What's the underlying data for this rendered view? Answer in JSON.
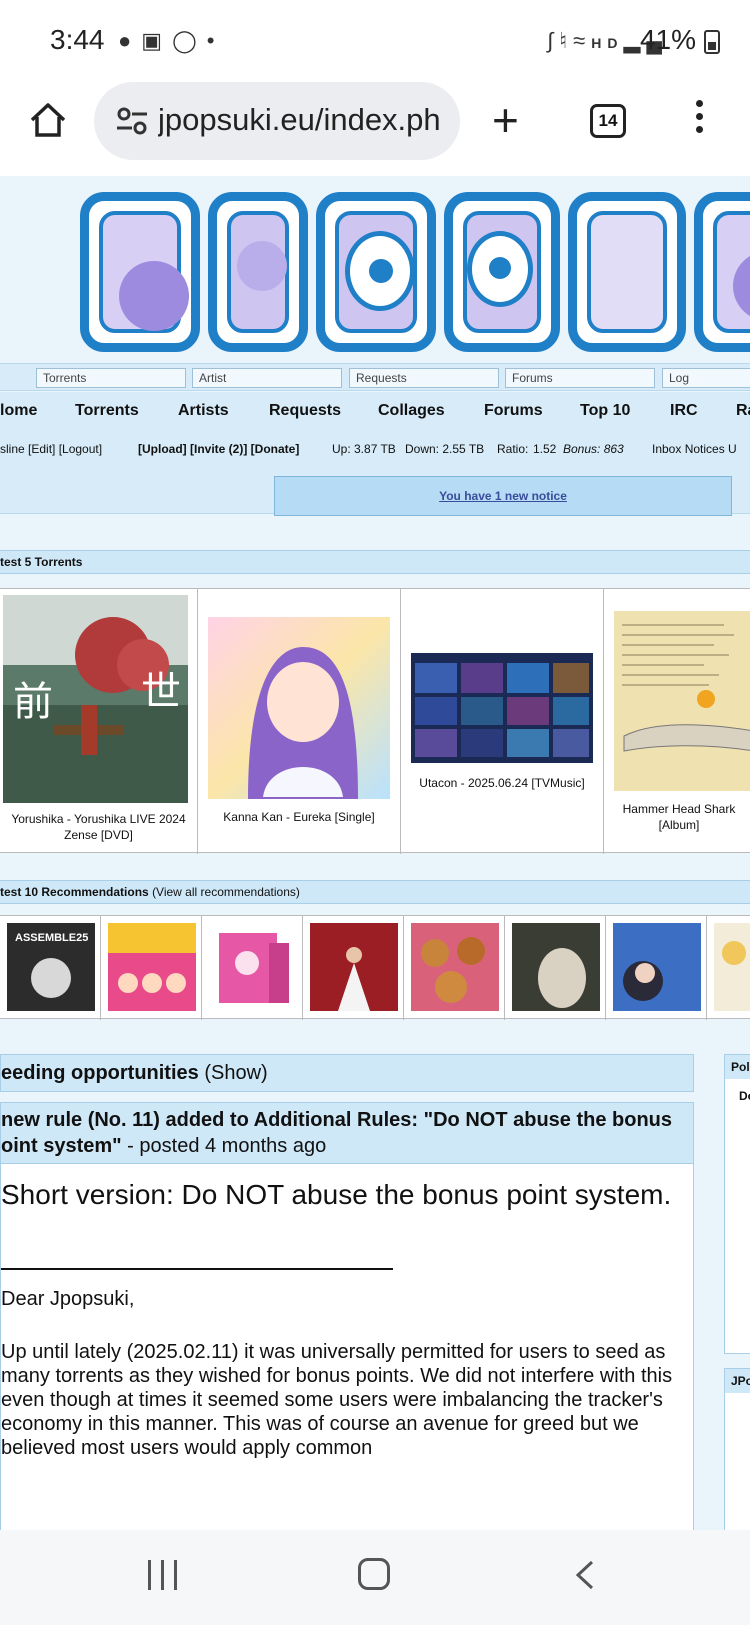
{
  "status": {
    "time": "3:44",
    "battery": "41%",
    "icons": [
      "chat-icon",
      "voicemail-icon",
      "instagram-icon",
      "dot-icon",
      "bluetooth-icon",
      "mute-icon",
      "wifi-icon",
      "hd-voice-icon",
      "signal-icon",
      "battery-icon"
    ]
  },
  "browser": {
    "url": "jpopsuki.eu/index.ph",
    "tab_count": "14"
  },
  "search": {
    "torrents": "Torrents",
    "artist": "Artist",
    "requests": "Requests",
    "forums": "Forums",
    "log": "Log"
  },
  "nav": {
    "items": [
      "lome",
      "Torrents",
      "Artists",
      "Requests",
      "Collages",
      "Forums",
      "Top 10",
      "IRC",
      "Ra"
    ]
  },
  "userbar": {
    "links": "sline  [Edit]  [Logout]",
    "actions": "[Upload]  [Invite (2)]  [Donate]",
    "up": "Up: 3.87 TB",
    "down": "Down: 2.55 TB",
    "ratio_label": "Ratio:",
    "ratio": "1.52",
    "bonus": "Bonus: 863",
    "right": "Inbox  Notices  U"
  },
  "notice": "You have 1 new notice",
  "latest": {
    "title": "test 5 Torrents",
    "items": [
      {
        "caption": "Yorushika - Yorushika LIVE 2024 Zense [DVD]"
      },
      {
        "caption": "Kanna Kan - Eureka [Single]"
      },
      {
        "caption": "Utacon - 2025.06.24 [TVMusic]"
      },
      {
        "caption": "Hammer Head Shark [Album]"
      }
    ]
  },
  "recs": {
    "title": "test 10 Recommendations",
    "link": "(View all recommendations)"
  },
  "seeding": {
    "title": "eeding opportunities",
    "toggle": "(Show)"
  },
  "news": {
    "headline": " new rule (No. 11) added to Additional Rules: \"Do NOT abuse the bonus oint system\"",
    "posted": " - posted 4 months ago",
    "big": "Short version: Do NOT abuse the bonus point system.",
    "dear": "Dear Jpopsuki,",
    "para": "Up until lately (2025.02.11) it was universally permitted for users to seed as many torrents as they wished for bonus points. We did not interfere with this even though at times it seemed some users were imbalancing the tracker's economy in this manner. This was of course an avenue for greed but we believed most users would apply common"
  },
  "sidebar": {
    "poll": "Pol",
    "poll_body": "Do",
    "jp": "JPo"
  }
}
